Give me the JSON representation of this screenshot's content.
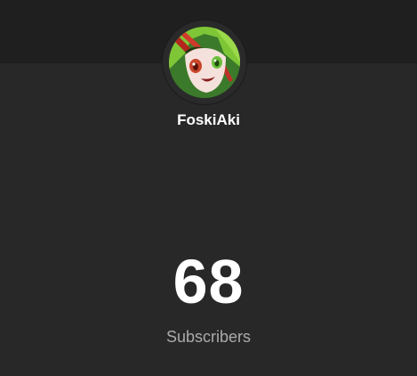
{
  "channel": {
    "name": "FoskiAki",
    "avatar_icon": "anime-character-avatar-icon"
  },
  "stats": {
    "count": "68",
    "label": "Subscribers"
  },
  "colors": {
    "background": "#282828",
    "banner": "#1f1f1f",
    "name_text": "#ffffff",
    "count_text": "#ffffff",
    "label_text": "#aaaaaa"
  }
}
